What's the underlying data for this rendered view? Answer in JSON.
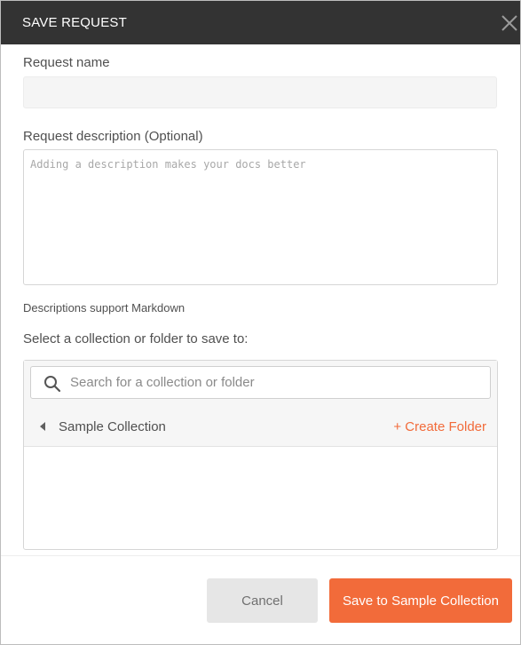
{
  "dialog": {
    "title": "SAVE REQUEST",
    "close_icon": "close-icon"
  },
  "request_name": {
    "label": "Request name",
    "value": "",
    "placeholder": ""
  },
  "request_description": {
    "label": "Request description (Optional)",
    "value": "",
    "placeholder": "Adding a description makes your docs better",
    "hint": "Descriptions support Markdown"
  },
  "collection_picker": {
    "label": "Select a collection or folder to save to:",
    "search": {
      "icon": "search-icon",
      "value": "",
      "placeholder": "Search for a collection or folder"
    },
    "collections": [
      {
        "icon": "caret-left-icon",
        "name": "Sample Collection",
        "create_folder_label": "+ Create Folder"
      }
    ]
  },
  "footer": {
    "cancel_label": "Cancel",
    "save_label": "Save to Sample Collection"
  },
  "colors": {
    "header_bg": "#333333",
    "accent": "#f26b3a",
    "cancel_bg": "#e6e6e6"
  }
}
